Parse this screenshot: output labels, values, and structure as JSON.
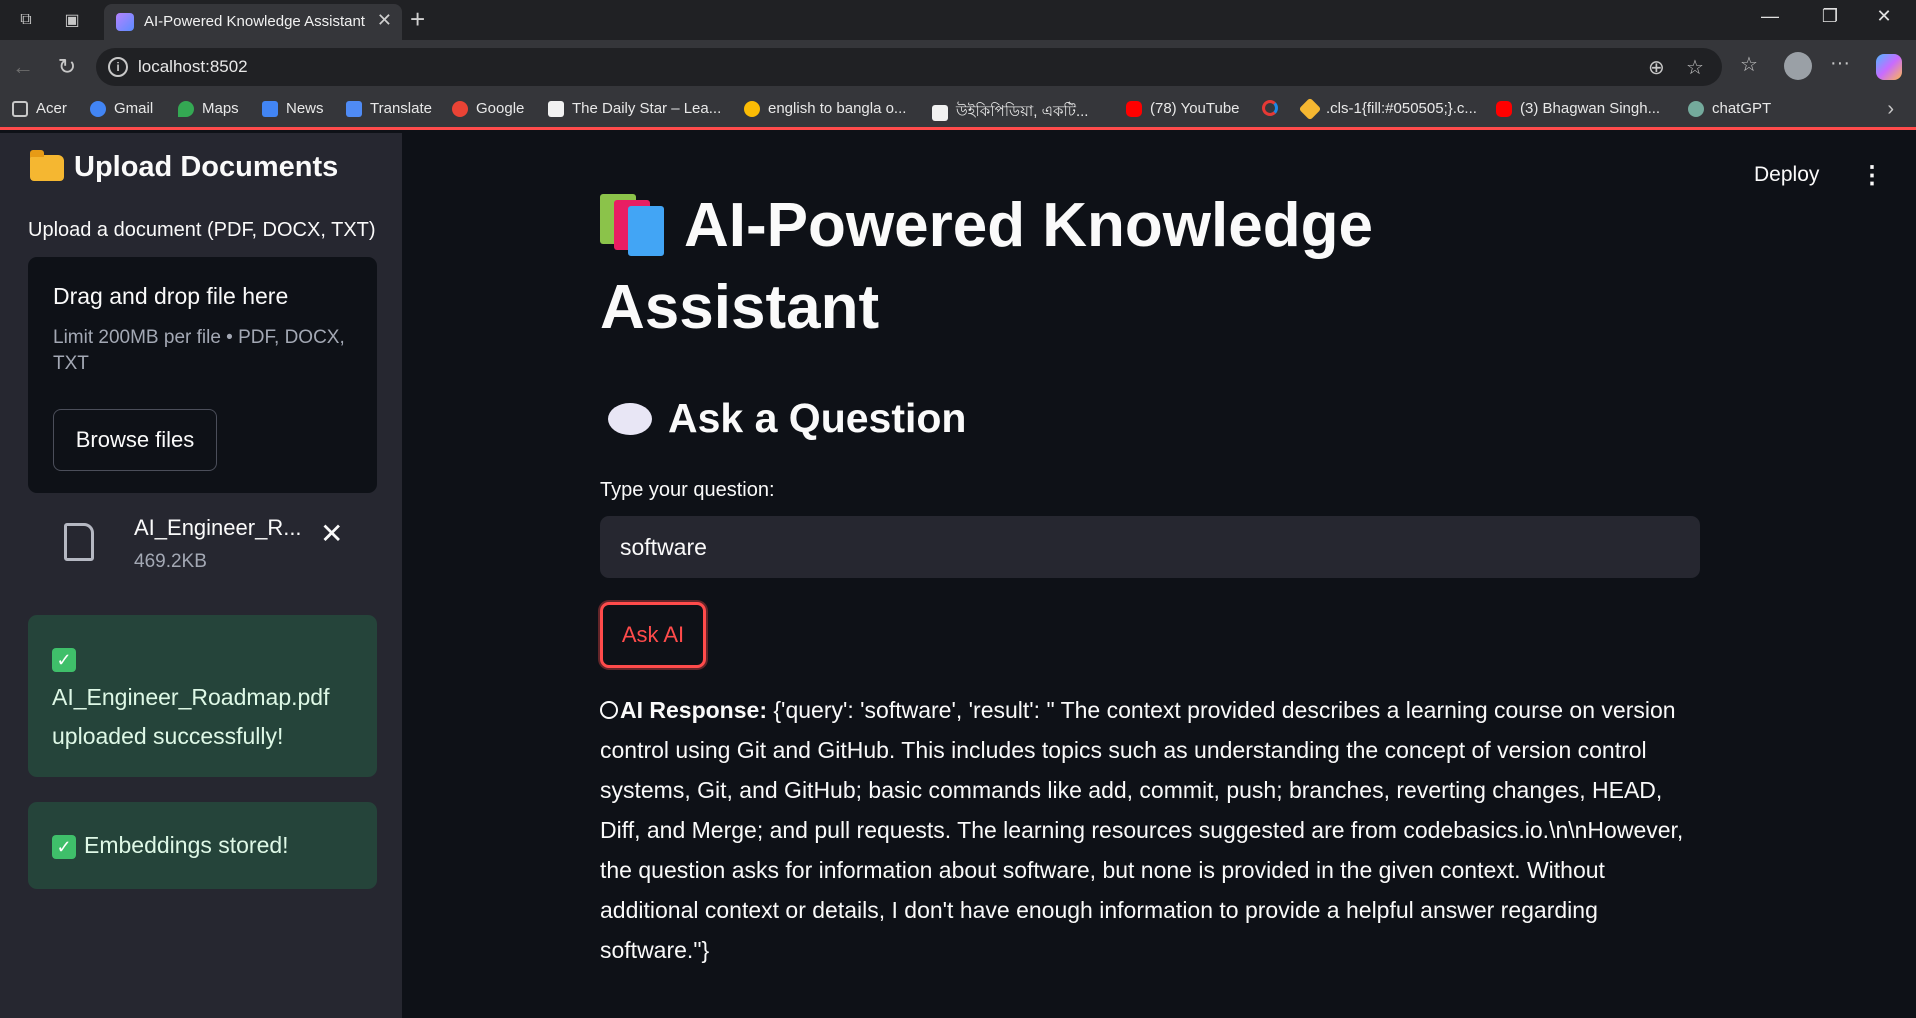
{
  "browser": {
    "tab_title": "AI-Powered Knowledge Assistant",
    "url": "localhost:8502",
    "bookmarks": [
      {
        "label": "Acer",
        "icon": "folder-icon"
      },
      {
        "label": "Gmail",
        "icon": "google-icon"
      },
      {
        "label": "Maps",
        "icon": "maps-icon"
      },
      {
        "label": "News",
        "icon": "news-icon"
      },
      {
        "label": "Translate",
        "icon": "translate-icon"
      },
      {
        "label": "Google",
        "icon": "google-icon"
      },
      {
        "label": "The Daily Star – Lea...",
        "icon": "daily-star-icon"
      },
      {
        "label": "english to bangla o...",
        "icon": "google-icon"
      },
      {
        "label": "উইকিপিডিয়া, একটি...",
        "icon": "wikipedia-icon"
      },
      {
        "label": "(78) YouTube",
        "icon": "youtube-icon"
      },
      {
        "label": "",
        "icon": "refresh-red-icon"
      },
      {
        "label": ".cls-1{fill:#050505;}.c...",
        "icon": "svg-file-icon"
      },
      {
        "label": "(3) Bhagwan Singh...",
        "icon": "youtube-icon"
      },
      {
        "label": "chatGPT",
        "icon": "chatgpt-icon"
      }
    ]
  },
  "sidebar": {
    "title": "Upload Documents",
    "uploader_label": "Upload a document (PDF, DOCX, TXT)",
    "dropzone_title": "Drag and drop file here",
    "dropzone_limit": "Limit 200MB per file • PDF, DOCX, TXT",
    "browse_label": "Browse files",
    "file_name": "AI_Engineer_R...",
    "file_size": "469.2KB",
    "success_upload": "AI_Engineer_Roadmap.pdf uploaded successfully!",
    "success_embed": "Embeddings stored!"
  },
  "main": {
    "deploy_label": "Deploy",
    "title": "AI-Powered Knowledge Assistant",
    "section_title": "Ask a Question",
    "question_label": "Type your question:",
    "question_value": "software",
    "ask_label": "Ask AI",
    "response_label": "AI Response:",
    "response_text": "{'query': 'software', 'result': \" The context provided describes a learning course on version control using Git and GitHub. This includes topics such as understanding the concept of version control systems, Git, and GitHub; basic commands like add, commit, push; branches, reverting changes, HEAD, Diff, and Merge; and pull requests. The learning resources suggested are from codebasics.io.\\n\\nHowever, the question asks for information about software, but none is provided in the given context. Without additional context or details, I don't have enough information to provide a helpful answer regarding software.\"}"
  },
  "colors": {
    "accent": "#ff4b4b",
    "sidebar_bg": "#262730",
    "main_bg": "#0e1117",
    "success_bg": "#25443a"
  }
}
